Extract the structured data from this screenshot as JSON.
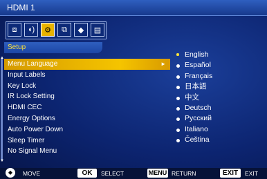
{
  "window": {
    "title": "HDMI 1"
  },
  "tabs": [
    {
      "icon": "picture-settings-icon",
      "glyph": "⧈"
    },
    {
      "icon": "sound-icon",
      "glyph": "🔊"
    },
    {
      "icon": "setup-icon",
      "glyph": "⚙",
      "active": true
    },
    {
      "icon": "input-source-icon",
      "glyph": "⧉"
    },
    {
      "icon": "package-icon",
      "glyph": "◆"
    },
    {
      "icon": "information-icon",
      "glyph": "▤"
    }
  ],
  "section": {
    "title": "Setup"
  },
  "menu": [
    {
      "label": "Menu Language",
      "selected": true
    },
    {
      "label": "Input Labels"
    },
    {
      "label": "Key Lock"
    },
    {
      "label": "IR Lock Setting"
    },
    {
      "label": "HDMI CEC"
    },
    {
      "label": "Energy Options"
    },
    {
      "label": "Auto Power Down"
    },
    {
      "label": "Sleep Timer"
    },
    {
      "label": "No Signal Menu"
    }
  ],
  "languages": [
    {
      "label": "English",
      "selected": true
    },
    {
      "label": "Español"
    },
    {
      "label": "Français"
    },
    {
      "label": "日本語"
    },
    {
      "label": "中文"
    },
    {
      "label": "Deutsch"
    },
    {
      "label": "Русский"
    },
    {
      "label": "Italiano"
    },
    {
      "label": "Čeština"
    }
  ],
  "footer": {
    "move": "MOVE",
    "ok_key": "OK",
    "select": "SELECT",
    "menu_key": "MENU",
    "return": "RETURN",
    "exit_key": "EXIT",
    "exit": "EXIT"
  },
  "colors": {
    "highlight": "#f5c400",
    "background": "#0c2470",
    "titlebar": "#2f5fbf"
  }
}
